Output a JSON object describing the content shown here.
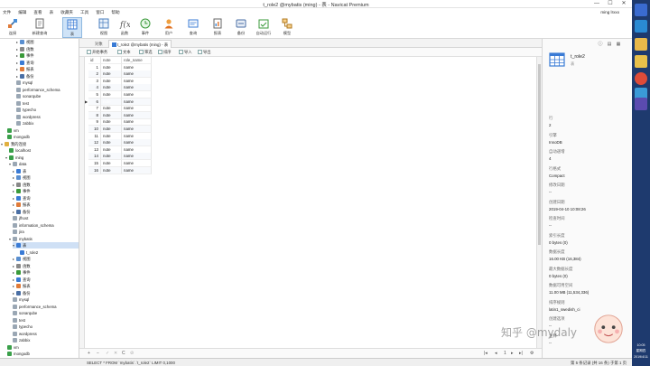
{
  "window": {
    "title": "t_role2 @mybatis (ming) - 表 - Navicat Premium",
    "minimize": "—",
    "maximize": "☐",
    "close": "✕"
  },
  "menu": {
    "items": [
      "文件",
      "编辑",
      "查看",
      "表",
      "收藏夹",
      "工具",
      "窗口",
      "帮助"
    ],
    "user": "ming lrxxx"
  },
  "toolbar": {
    "items": [
      "连接",
      "新建查询",
      "表",
      "视图",
      "函数",
      "事件",
      "用户",
      "查询",
      "报表",
      "备份",
      "自动运行",
      "模型"
    ]
  },
  "sidebar": {
    "nodes": [
      {
        "label": "视图",
        "icon": "view-icon",
        "exp": "▸"
      },
      {
        "label": "函数",
        "icon": "function-icon",
        "exp": "▸"
      },
      {
        "label": "事件",
        "icon": "event-icon",
        "exp": "▸"
      },
      {
        "label": "查询",
        "icon": "query-icon",
        "exp": "▸"
      },
      {
        "label": "报表",
        "icon": "report-icon",
        "exp": "▸"
      },
      {
        "label": "备份",
        "icon": "backup-icon",
        "exp": "▸"
      },
      {
        "label": "mysql",
        "icon": "database-icon",
        "exp": ""
      },
      {
        "label": "performance_schema",
        "icon": "database-icon",
        "exp": ""
      },
      {
        "label": "sonarqube",
        "icon": "database-icon",
        "exp": ""
      },
      {
        "label": "test",
        "icon": "database-icon",
        "exp": ""
      },
      {
        "label": "typecho",
        "icon": "database-icon",
        "exp": ""
      },
      {
        "label": "wordpress",
        "icon": "database-icon",
        "exp": ""
      },
      {
        "label": "zabbix",
        "icon": "database-icon",
        "exp": ""
      },
      {
        "label": "vm",
        "icon": "connection-icon",
        "exp": ""
      },
      {
        "label": "mongodb",
        "icon": "connection-icon",
        "exp": ""
      },
      {
        "label": "我的连接",
        "icon": "folder-icon",
        "exp": "▾"
      },
      {
        "label": "localhost",
        "icon": "connection-icon",
        "exp": ""
      },
      {
        "label": "ming",
        "icon": "connection-icon",
        "exp": "▾"
      },
      {
        "label": "data",
        "icon": "database-icon",
        "exp": "▾"
      },
      {
        "label": "表",
        "icon": "table-icon",
        "exp": "▸"
      },
      {
        "label": "视图",
        "icon": "view-icon",
        "exp": "▸"
      },
      {
        "label": "函数",
        "icon": "function-icon",
        "exp": "▸"
      },
      {
        "label": "事件",
        "icon": "event-icon",
        "exp": "▸"
      },
      {
        "label": "查询",
        "icon": "query-icon",
        "exp": "▸"
      },
      {
        "label": "报表",
        "icon": "report-icon",
        "exp": "▸"
      },
      {
        "label": "备份",
        "icon": "backup-icon",
        "exp": "▸"
      },
      {
        "label": "jfhost",
        "icon": "database-icon",
        "exp": ""
      },
      {
        "label": "information_schema",
        "icon": "database-icon",
        "exp": ""
      },
      {
        "label": "jira",
        "icon": "database-icon",
        "exp": ""
      },
      {
        "label": "mybatis",
        "icon": "database-icon",
        "exp": "▾"
      },
      {
        "label": "表",
        "icon": "table-icon",
        "exp": "▾"
      },
      {
        "label": "t_role2",
        "icon": "table-icon",
        "exp": ""
      },
      {
        "label": "视图",
        "icon": "view-icon",
        "exp": "▸"
      },
      {
        "label": "函数",
        "icon": "function-icon",
        "exp": "▸"
      },
      {
        "label": "事件",
        "icon": "event-icon",
        "exp": "▸"
      },
      {
        "label": "查询",
        "icon": "query-icon",
        "exp": "▸"
      },
      {
        "label": "报表",
        "icon": "report-icon",
        "exp": "▸"
      },
      {
        "label": "备份",
        "icon": "backup-icon",
        "exp": "▸"
      },
      {
        "label": "mysql",
        "icon": "database-icon",
        "exp": ""
      },
      {
        "label": "performance_schema",
        "icon": "database-icon",
        "exp": ""
      },
      {
        "label": "sonarqube",
        "icon": "database-icon",
        "exp": ""
      },
      {
        "label": "test",
        "icon": "database-icon",
        "exp": ""
      },
      {
        "label": "typecho",
        "icon": "database-icon",
        "exp": ""
      },
      {
        "label": "wordpress",
        "icon": "database-icon",
        "exp": ""
      },
      {
        "label": "zabbix",
        "icon": "database-icon",
        "exp": ""
      },
      {
        "label": "vm",
        "icon": "connection-icon",
        "exp": ""
      },
      {
        "label": "mongodb",
        "icon": "connection-icon",
        "exp": ""
      }
    ]
  },
  "tabs": {
    "objects": "对象",
    "table": "t_role2 @mybatis (ming) - 表"
  },
  "subtoolbar": {
    "begin_tx": "开始事务",
    "text": "文本",
    "filter": "筛选",
    "sort": "排序",
    "import": "导入",
    "export": "导出"
  },
  "grid": {
    "columns": [
      "id",
      "note",
      "role_name"
    ],
    "rows": [
      [
        "1",
        "note",
        "name"
      ],
      [
        "2",
        "note",
        "name"
      ],
      [
        "3",
        "note",
        "name"
      ],
      [
        "4",
        "note",
        "name"
      ],
      [
        "5",
        "note",
        "name"
      ],
      [
        "6",
        "note",
        "name"
      ],
      [
        "7",
        "note",
        "name"
      ],
      [
        "8",
        "note",
        "name"
      ],
      [
        "9",
        "note",
        "name"
      ],
      [
        "10",
        "note",
        "name"
      ],
      [
        "11",
        "note",
        "name"
      ],
      [
        "12",
        "note",
        "name"
      ],
      [
        "13",
        "note",
        "name"
      ],
      [
        "14",
        "note",
        "name"
      ],
      [
        "15",
        "note",
        "name"
      ],
      [
        "16",
        "note",
        "name"
      ]
    ],
    "current_row": 5,
    "highlight_cell": {
      "row": 5,
      "col": 1
    }
  },
  "bottombar": {
    "add": "+",
    "remove": "−",
    "check": "✓",
    "cancel": "✕",
    "refresh": "C",
    "stop": "⊘"
  },
  "status": {
    "sql": "SELECT * FROM `mybatis`.`t_role2` LIMIT 0,1000",
    "records": "第 5 条记录 (共 16 条) 于第 1 页"
  },
  "info": {
    "name": "t_role2",
    "subtitle": "表",
    "props": [
      {
        "label": "行",
        "value": "2"
      },
      {
        "label": "引擎",
        "value": "InnoDB"
      },
      {
        "label": "自动递增",
        "value": "4"
      },
      {
        "label": "行格式",
        "value": "Compact"
      },
      {
        "label": "修改日期",
        "value": "--"
      },
      {
        "label": "创建日期",
        "value": "2019-04-10 10:08:26"
      },
      {
        "label": "检查时间",
        "value": "--"
      },
      {
        "label": "索引长度",
        "value": "0 bytes (0)"
      },
      {
        "label": "数据长度",
        "value": "16.00 KB (16,384)"
      },
      {
        "label": "最大数据长度",
        "value": "0 bytes (0)"
      },
      {
        "label": "数据可用空间",
        "value": "11.00 MB (11,534,336)"
      },
      {
        "label": "排序规则",
        "value": "latin1_swedish_ci"
      },
      {
        "label": "创建选项",
        "value": "--"
      },
      {
        "label": "注释",
        "value": "--"
      }
    ]
  },
  "watermark": "知乎 @mydaly",
  "taskbar": {
    "time": "10:05",
    "day": "星期四",
    "date": "2019/4/11"
  },
  "colors": {
    "accent": "#2c7be5",
    "selection": "#cfe0f5",
    "taskbar": "#1e3a6e"
  }
}
